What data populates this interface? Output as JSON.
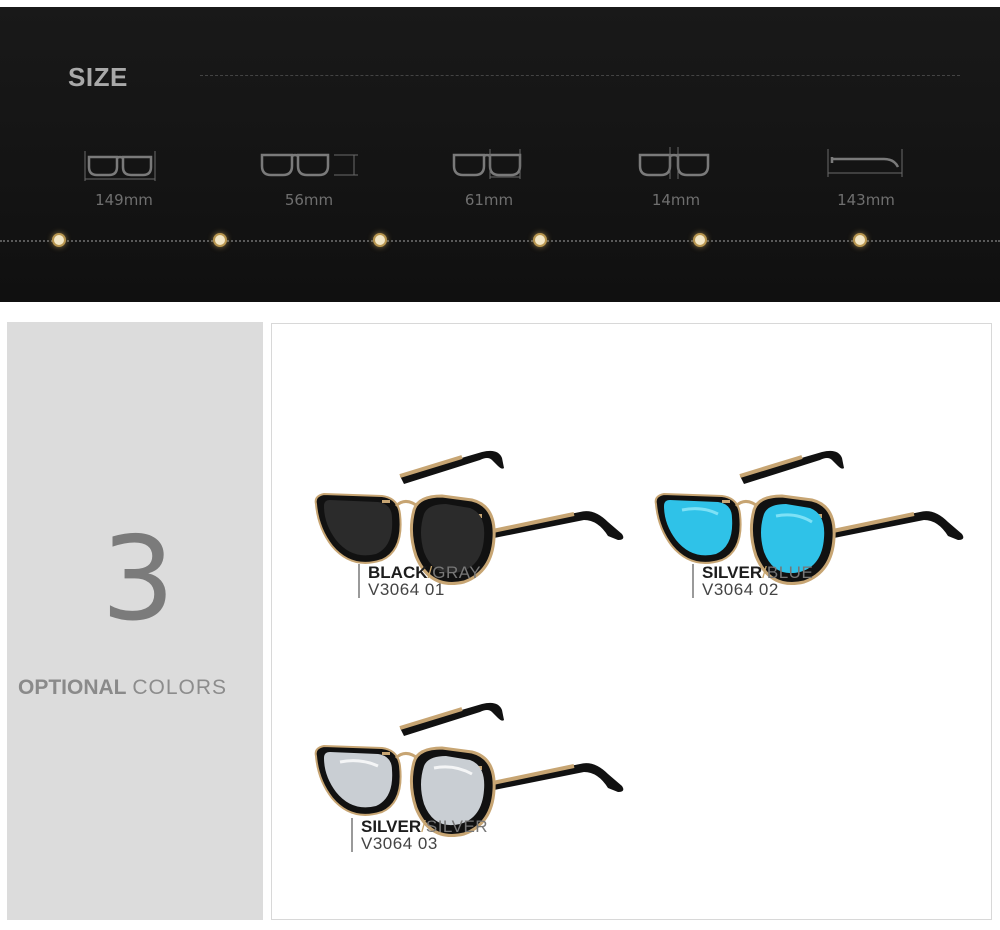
{
  "size_section": {
    "title": "SIZE",
    "measurements": [
      {
        "value": "149mm",
        "icon": "frame-width-icon"
      },
      {
        "value": "56mm",
        "icon": "lens-width-icon"
      },
      {
        "value": "61mm",
        "icon": "lens-height-icon"
      },
      {
        "value": "14mm",
        "icon": "bridge-width-icon"
      },
      {
        "value": "143mm",
        "icon": "temple-length-icon"
      }
    ]
  },
  "colors_section": {
    "count": "3",
    "heading_strong": "OPTIONAL",
    "heading_light": "COLORS",
    "variants": [
      {
        "frame": "BLACK",
        "separator": "/",
        "lens": "GRAY",
        "code": "V3064  01",
        "lens_color": "#2b2b2b"
      },
      {
        "frame": "SILVER",
        "separator": "/",
        "lens": "BLUE",
        "code": "V3064  02",
        "lens_color": "#2fc2e8"
      },
      {
        "frame": "SILVER",
        "separator": "/",
        "lens": "SILVER",
        "code": "V3064  03",
        "lens_color": "#c9ced3"
      }
    ]
  },
  "colors": {
    "frame_gold": "#c7a573",
    "frame_black": "#111111",
    "accent_dot": "#b7954f"
  }
}
